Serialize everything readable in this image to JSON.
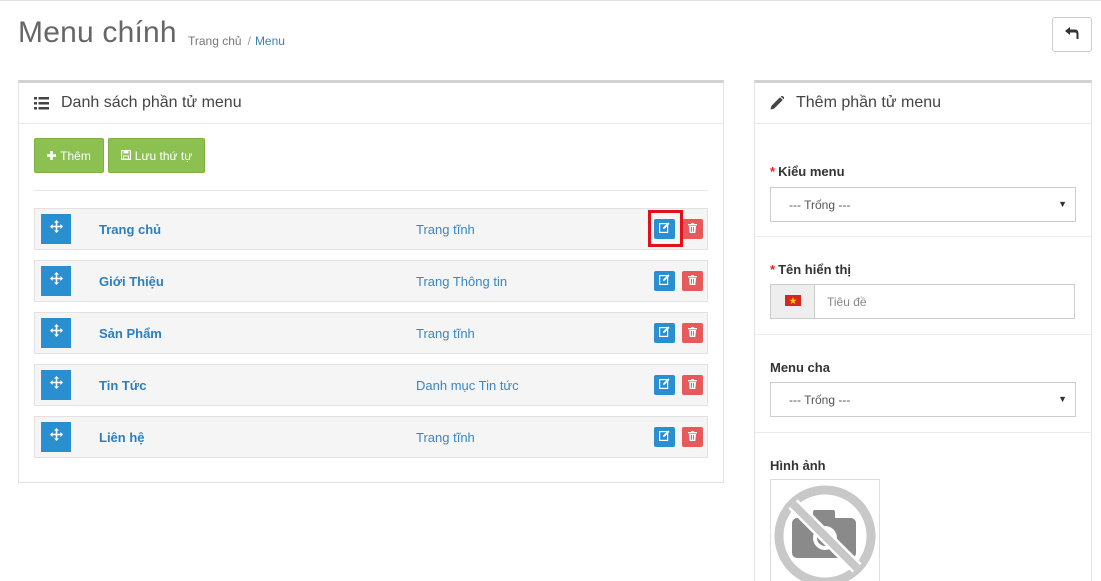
{
  "header": {
    "title": "Menu chính",
    "breadcrumb": {
      "home": "Trang chủ",
      "separator": "/",
      "current": "Menu"
    }
  },
  "back_button": {
    "icon": "undo-icon"
  },
  "left_panel": {
    "title": "Danh sách phần tử menu",
    "icon": "list-icon",
    "add_label": "Thêm",
    "save_order_label": "Lưu thứ tự",
    "items": [
      {
        "name": "Trang chủ",
        "type": "Trang tĩnh"
      },
      {
        "name": "Giới Thiệu",
        "type": "Trang Thông tin"
      },
      {
        "name": "Sản Phẩm",
        "type": "Trang tĩnh"
      },
      {
        "name": "Tin Tức",
        "type": "Danh mục Tin tức"
      },
      {
        "name": "Liên hệ",
        "type": "Trang tĩnh"
      }
    ]
  },
  "right_panel": {
    "title": "Thêm phần tử menu",
    "icon": "pencil-icon",
    "menu_type": {
      "required_mark": "*",
      "label": "Kiểu menu",
      "value": "--- Trống ---"
    },
    "display_name": {
      "required_mark": "*",
      "label": "Tên hiển thị",
      "placeholder": "Tiêu đề",
      "flag": "vietnam-flag-icon"
    },
    "parent_menu": {
      "label": "Menu cha",
      "value": "--- Trống ---"
    },
    "image": {
      "label": "Hình ảnh",
      "placeholder_icon": "no-camera-icon"
    }
  },
  "colors": {
    "primary": "#2a8fd0",
    "success": "#8cc152",
    "danger": "#e8595a",
    "highlight": "#e2101a"
  }
}
